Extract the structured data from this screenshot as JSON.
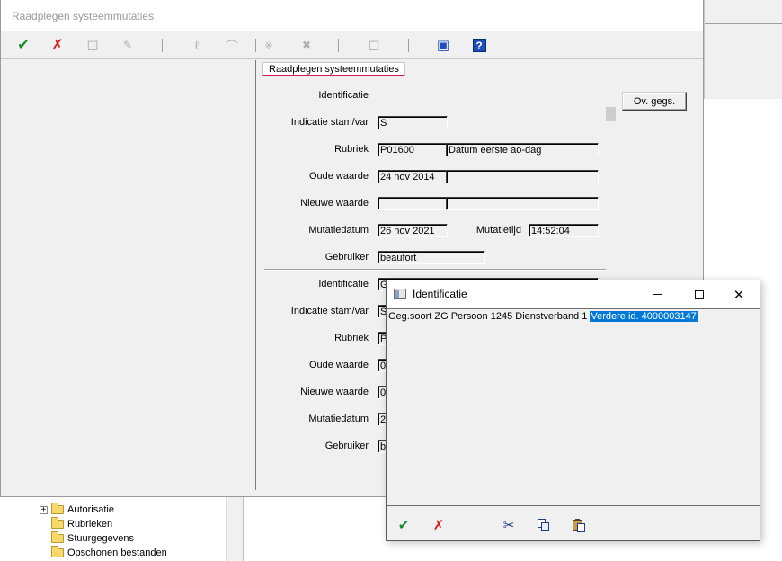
{
  "main_window": {
    "title": "Raadplegen systeemmutaties",
    "tab_label": "Raadplegen systeemmutaties",
    "ov_button_label": "Ov. gegs."
  },
  "labels": {
    "identificatie": "Identificatie",
    "indicatie": "Indicatie stam/var",
    "rubriek": "Rubriek",
    "oude_waarde": "Oude waarde",
    "nieuwe_waarde": "Nieuwe waarde",
    "mutatiedatum": "Mutatiedatum",
    "mutatietijd": "Mutatietijd",
    "gebruiker": "Gebruiker"
  },
  "record1": {
    "indicatie": "S",
    "rubriek_code": "P01600",
    "rubriek_omschrijving": "Datum eerste ao-dag",
    "oude_waarde": "24 nov 2014",
    "oude_waarde_2": "",
    "nieuwe_waarde": "",
    "nieuwe_waarde_2": "",
    "mutatiedatum": "26 nov 2021",
    "mutatietijd": "14:52:04",
    "gebruiker": "beaufort"
  },
  "record2": {
    "identificatie": "G",
    "indicatie": "S",
    "rubriek": "P",
    "oude_waarde": "0",
    "nieuwe_waarde": "0",
    "mutatiedatum": "2",
    "gebruiker": "b"
  },
  "popup": {
    "title": "Identificatie",
    "text_plain": "Geg.soort ZG  Persoon 1245  Dienstverband 1 ",
    "text_selected": "Verdere id. 4000003147"
  },
  "tree": {
    "items": [
      "Autorisatie",
      "Rubrieken",
      "Stuurgegevens",
      "Opschonen bestanden"
    ]
  },
  "icons": {
    "ok": "checkmark-icon",
    "cancel": "cross-icon",
    "cut": "scissors-icon",
    "copy": "copy-icon",
    "paste": "paste-icon",
    "help": "help-icon"
  },
  "colors": {
    "accent_underline": "#d4145a",
    "selection": "#0078d7",
    "ok_green": "#1a8a2c",
    "cancel_red": "#d42020",
    "toolbar_blue": "#1f4fb8"
  }
}
